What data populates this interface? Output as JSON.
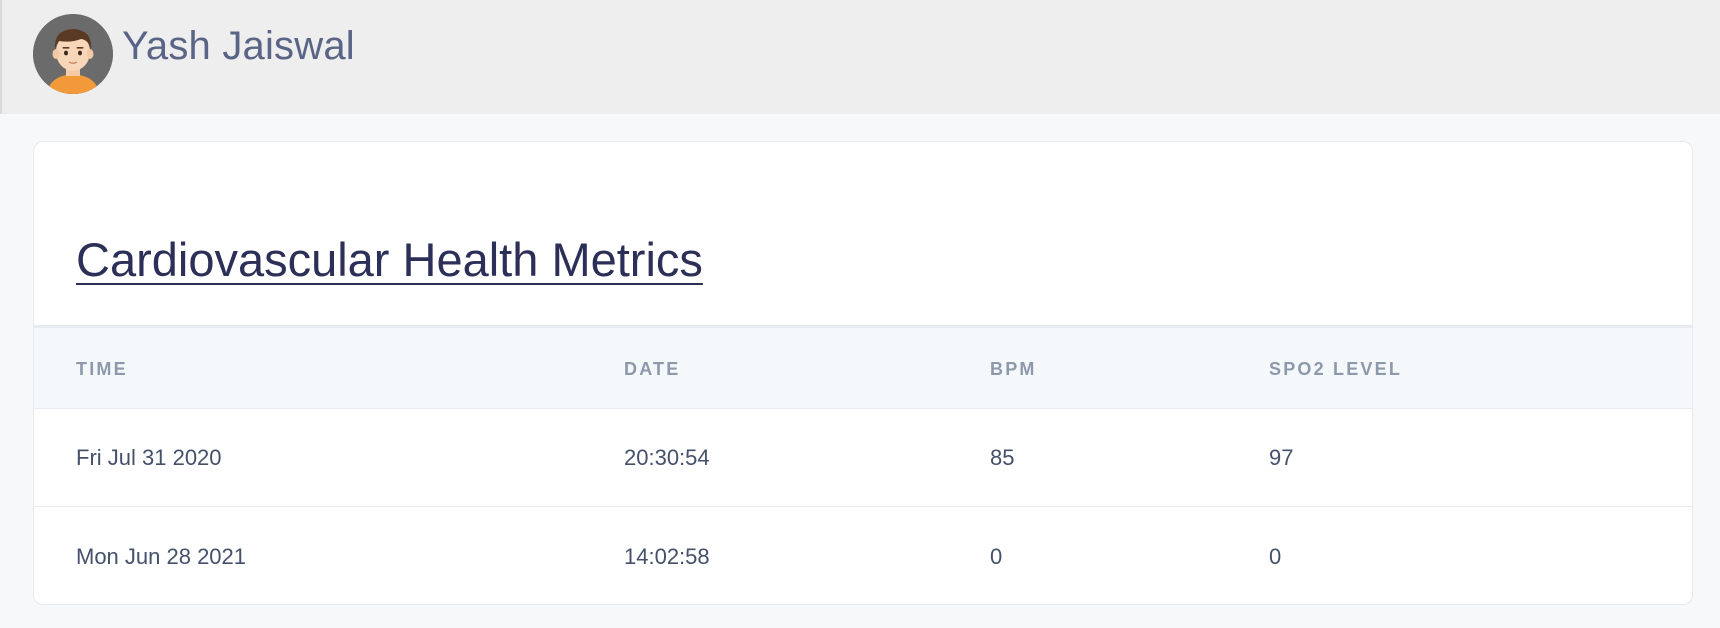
{
  "user": {
    "name": "Yash Jaiswal",
    "avatar_icon": "user-avatar-icon"
  },
  "card": {
    "title": "Cardiovascular Health Metrics"
  },
  "table": {
    "headers": [
      "TIME",
      "DATE",
      "BPM",
      "SPO2 LEVEL"
    ],
    "rows": [
      [
        "Fri Jul 31 2020",
        "20:30:54",
        "85",
        "97"
      ],
      [
        "Mon Jun 28 2021",
        "14:02:58",
        "0",
        "0"
      ]
    ]
  },
  "colors": {
    "topbar_bg": "#eeeeee",
    "title": "#2c2f57",
    "header_text": "#8d98aa",
    "cell_text": "#45506a"
  }
}
